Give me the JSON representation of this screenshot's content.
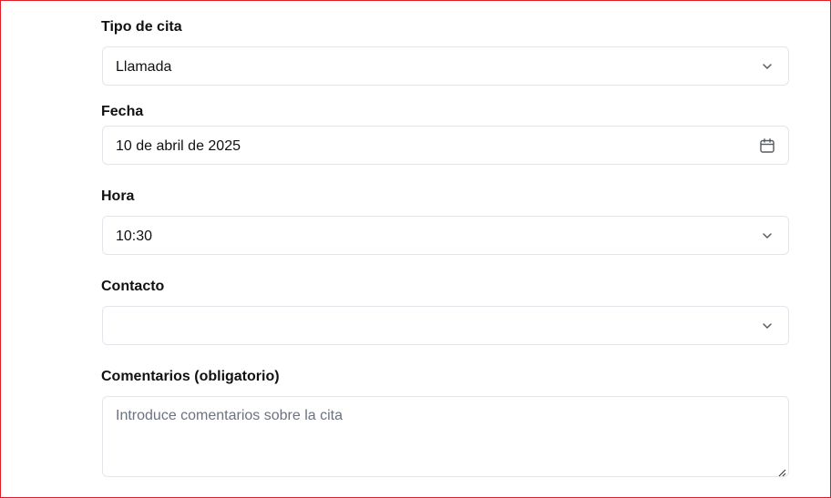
{
  "form": {
    "tipo_cita": {
      "label": "Tipo de cita",
      "value": "Llamada",
      "icon": "chevron-down-icon"
    },
    "fecha": {
      "label": "Fecha",
      "value": "10 de abril de 2025",
      "icon": "calendar-icon"
    },
    "hora": {
      "label": "Hora",
      "value": "10:30",
      "icon": "chevron-down-icon"
    },
    "contacto": {
      "label": "Contacto",
      "value": "",
      "icon": "chevron-down-icon"
    },
    "comentarios": {
      "label": "Comentarios (obligatorio)",
      "placeholder": "Introduce comentarios sobre la cita",
      "icon": "resize-handle-icon"
    }
  },
  "colors": {
    "frame_border": "#e11d2a",
    "field_border": "#e2e6ea",
    "placeholder_text": "#6b7280"
  }
}
